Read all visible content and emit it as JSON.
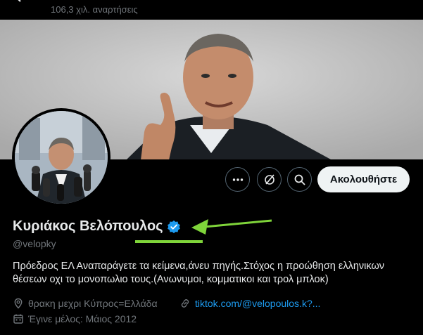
{
  "header": {
    "post_count": "106,3 χιλ. αναρτήσεις"
  },
  "actions": {
    "more_icon": "more-icon",
    "grok_icon": "grok-icon",
    "search_icon": "search-icon",
    "follow_label": "Ακολουθήστε"
  },
  "profile": {
    "display_name": "Κυριάκος Βελόπουλος",
    "verified": true,
    "handle": "@velopky",
    "bio": "Πρόεδρος ΕΛ Αναπαράγετε τα κείμενα,άνευ πηγής.Στόχος η προώθηση ελληνικων θέσεων οχι το μονοπωλιο τους.(Ανωνυμοι, κομματικοι και τρολ μπλοκ)",
    "location": "θρακη μεχρι Κύπρος=Ελλάδα",
    "link": "tiktok.com/@velopoulos.k?...",
    "joined": "Έγινε μέλος: Μάιος 2012"
  },
  "colors": {
    "background": "#000000",
    "link": "#1d9bf0",
    "muted": "#71767b",
    "verified": "#1d9bf0",
    "annotation_arrow": "#7fd43a"
  }
}
